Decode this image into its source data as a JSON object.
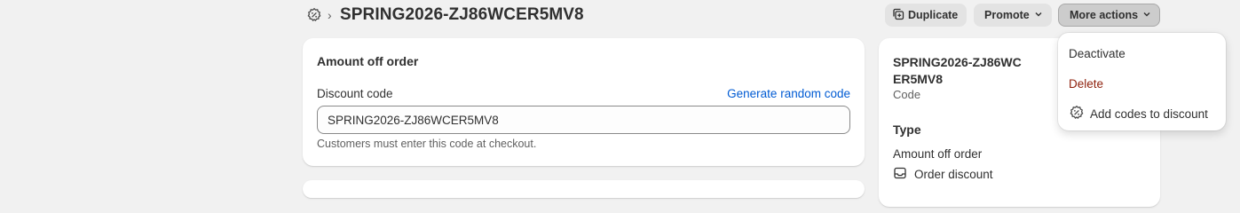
{
  "header": {
    "breadcrumb_separator": "›",
    "title": "SPRING2026-ZJ86WCER5MV8",
    "breadcrumb_icon": "discount-gear-icon"
  },
  "actions": {
    "duplicate_label": "Duplicate",
    "promote_label": "Promote",
    "more_actions_label": "More actions"
  },
  "more_actions_menu": {
    "items": [
      {
        "label": "Deactivate"
      },
      {
        "label": "Delete",
        "color": "#8e1f0b"
      },
      {
        "label": "Add codes to discount",
        "icon": "discount-badge-icon"
      }
    ]
  },
  "main_card": {
    "title": "Amount off order",
    "field_label": "Discount code",
    "generate_link": "Generate random code",
    "code_value": "SPRING2026-ZJ86WCER5MV8",
    "help_text": "Customers must enter this code at checkout."
  },
  "summary_card": {
    "code": "SPRING2026-ZJ86WCER5MV8",
    "code_sublabel": "Code",
    "type_heading": "Type",
    "type_value": "Amount off order",
    "type_detail": "Order discount",
    "type_detail_icon": "order-inbox-icon"
  },
  "colors": {
    "link": "#005bd3",
    "destructive": "#8e1f0b",
    "page_bg": "#f1f1f1"
  }
}
